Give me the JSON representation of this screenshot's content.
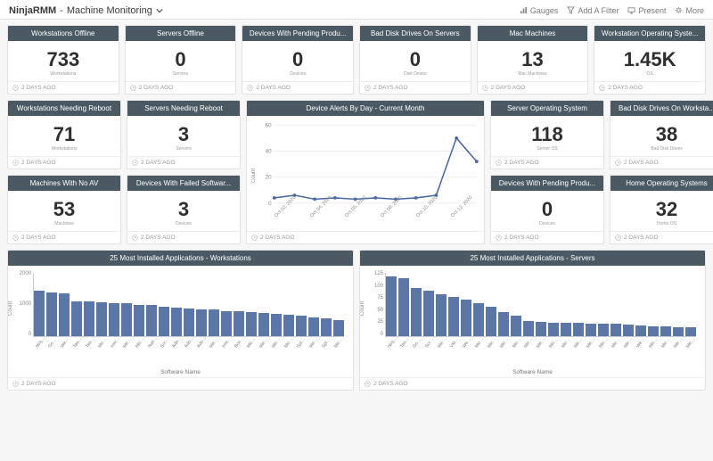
{
  "header": {
    "app": "NinjaRMM",
    "title": "Machine Monitoring",
    "actions": {
      "gauges": "Gauges",
      "add_filter": "Add A Filter",
      "present": "Present",
      "more": "More"
    }
  },
  "timestamp_label": "2 DAYS AGO",
  "stats_row1": [
    {
      "title": "Workstations Offline",
      "value": "733",
      "caption": "Workstations"
    },
    {
      "title": "Servers Offline",
      "value": "0",
      "caption": "Servers"
    },
    {
      "title": "Devices With Pending Produ...",
      "value": "0",
      "caption": "Devices"
    },
    {
      "title": "Bad Disk Drives On Servers",
      "value": "0",
      "caption": "Disk Drives"
    },
    {
      "title": "Mac Machines",
      "value": "13",
      "caption": "Mac Machines"
    },
    {
      "title": "Workstation Operating Syste...",
      "value": "1.45K",
      "caption": "OS"
    }
  ],
  "left_col": [
    {
      "title": "Workstations Needing Reboot",
      "value": "71",
      "caption": "Workstations"
    },
    {
      "title": "Machines With No AV",
      "value": "53",
      "caption": "Machines"
    }
  ],
  "left_col2": [
    {
      "title": "Servers Needing Reboot",
      "value": "3",
      "caption": "Servers"
    },
    {
      "title": "Devices With Failed Softwar...",
      "value": "3",
      "caption": "Devices"
    }
  ],
  "right_col": [
    {
      "title": "Server Operating System",
      "value": "118",
      "caption": "Server OS"
    },
    {
      "title": "Devices With Pending Produ...",
      "value": "0",
      "caption": "Devices"
    }
  ],
  "right_col2": [
    {
      "title": "Bad Disk Drives On Worksta...",
      "value": "38",
      "caption": "Bad Disk Drives"
    },
    {
      "title": "Home Operating Systems",
      "value": "32",
      "caption": "Home OS"
    }
  ],
  "line_chart": {
    "title": "Device Alerts By Day - Current Month",
    "ylabel": "Count",
    "ylim": [
      0,
      60
    ],
    "yticks": [
      0,
      20,
      40,
      60
    ]
  },
  "bar_charts": {
    "left": {
      "title": "25 Most Installed Applications - Workstations",
      "xlabel": "Software Name",
      "ylabel": "Count",
      "ymax": 2000,
      "yticks": [
        2000,
        1000,
        0
      ]
    },
    "right": {
      "title": "25 Most Installed Applications - Servers",
      "xlabel": "Software Name",
      "ylabel": "Count",
      "ymax": 125,
      "yticks": [
        125,
        100,
        75,
        50,
        25,
        0
      ]
    }
  },
  "chart_data": [
    {
      "type": "line",
      "title": "Device Alerts By Day - Current Month",
      "xlabel": "",
      "ylabel": "Count",
      "ylim": [
        0,
        60
      ],
      "x": [
        "Oct 02, 2020",
        "Oct 04, 2020",
        "Oct 06, 2020",
        "Oct 08, 2020",
        "Oct 10, 2020",
        "Oct 12, 2020"
      ],
      "x_full": [
        "Oct 02, 2020",
        "Oct 03, 2020",
        "Oct 04, 2020",
        "Oct 05, 2020",
        "Oct 06, 2020",
        "Oct 07, 2020",
        "Oct 08, 2020",
        "Oct 09, 2020",
        "Oct 10, 2020",
        "Oct 11, 2020",
        "Oct 12, 2020"
      ],
      "values": [
        4,
        6,
        3,
        4,
        3,
        4,
        3,
        4,
        6,
        50,
        32
      ]
    },
    {
      "type": "bar",
      "title": "25 Most Installed Applications - Workstations",
      "xlabel": "Software Name",
      "ylabel": "Count",
      "ylim": [
        0,
        2000
      ],
      "categories": [
        "NinjaRMMAgent",
        "Google Chrome",
        "Webex SecureVpn",
        "TeamViewer Machinewide",
        "TeamViewer Host",
        "Microsoft PowerShell",
        "Intel(R) Processor Graphics",
        "Microsoft Silverlight",
        "Microsoft Visual Apps for",
        "Native High Driver",
        "ScreenConnect Client (f...",
        "Adobe Flash Player 32...",
        "Adobe Acrobat Reader",
        "Adobe Acrobat Reader DC",
        "Microsoft Teams",
        "Intel(R)Wireless Agent",
        "Box Drive",
        "Microsoft Agent",
        "Microsoft Visual C++ 20...",
        "Microsoft Redistributable",
        "Microsoft Visual C++ 20...",
        "Splashtop Agent",
        "Microsoft Visual C++ 20...",
        "Splashtop Software Upd...",
        "Microsoft Visual C++ 20..."
      ],
      "values": [
        1450,
        1380,
        1350,
        1100,
        1100,
        1060,
        1050,
        1030,
        1000,
        980,
        930,
        900,
        870,
        850,
        840,
        800,
        780,
        760,
        730,
        700,
        680,
        650,
        600,
        560,
        520
      ]
    },
    {
      "type": "bar",
      "title": "25 Most Installed Applications - Servers",
      "xlabel": "Software Name",
      "ylabel": "Count",
      "ylim": [
        0,
        125
      ],
      "categories": [
        "NinjaRMMAgent",
        "TeamViewer Host",
        "Google Chrome",
        "ScreenConnect Client (f...",
        "Microsoft Visual C++ 20...",
        "VMware Tools",
        "Webex SecureVpn",
        "Microsoft PowerShell",
        "Microsoft Visual C++ 20...",
        "Microsoft Visual C++ 20...",
        "Microsoft SQL Server 20...",
        "Microsoft Visual C++ 20...",
        "Microsoft Visual C++ 20...",
        "Microsoft SQL Server 20...",
        "Microsoft Visual C++ 20...",
        "Microsoft Visual C++ 20...",
        "Microsoft SQL Server 20...",
        "Microsoft System CLR Ty...",
        "Microsoft System CLR Ty...",
        "Microsoft Download Mgr",
        "Webex AD Connector",
        "Microsoft Visual C++ 20...",
        "Microsoft Visual C++ 20...",
        "Microsoft Visual C++ 20...",
        "Microsoft Visual C++ 20..."
      ],
      "values": [
        118,
        115,
        95,
        90,
        82,
        78,
        72,
        65,
        58,
        48,
        40,
        30,
        28,
        27,
        26,
        26,
        25,
        24,
        24,
        23,
        22,
        20,
        19,
        18,
        17
      ]
    }
  ]
}
